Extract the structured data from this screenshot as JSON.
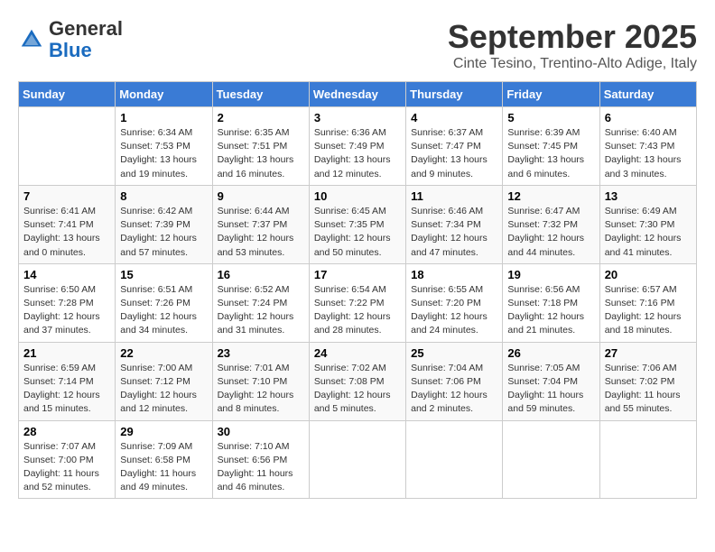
{
  "header": {
    "logo_general": "General",
    "logo_blue": "Blue",
    "month": "September 2025",
    "location": "Cinte Tesino, Trentino-Alto Adige, Italy"
  },
  "weekdays": [
    "Sunday",
    "Monday",
    "Tuesday",
    "Wednesday",
    "Thursday",
    "Friday",
    "Saturday"
  ],
  "weeks": [
    [
      {
        "day": "",
        "info": ""
      },
      {
        "day": "1",
        "info": "Sunrise: 6:34 AM\nSunset: 7:53 PM\nDaylight: 13 hours\nand 19 minutes."
      },
      {
        "day": "2",
        "info": "Sunrise: 6:35 AM\nSunset: 7:51 PM\nDaylight: 13 hours\nand 16 minutes."
      },
      {
        "day": "3",
        "info": "Sunrise: 6:36 AM\nSunset: 7:49 PM\nDaylight: 13 hours\nand 12 minutes."
      },
      {
        "day": "4",
        "info": "Sunrise: 6:37 AM\nSunset: 7:47 PM\nDaylight: 13 hours\nand 9 minutes."
      },
      {
        "day": "5",
        "info": "Sunrise: 6:39 AM\nSunset: 7:45 PM\nDaylight: 13 hours\nand 6 minutes."
      },
      {
        "day": "6",
        "info": "Sunrise: 6:40 AM\nSunset: 7:43 PM\nDaylight: 13 hours\nand 3 minutes."
      }
    ],
    [
      {
        "day": "7",
        "info": "Sunrise: 6:41 AM\nSunset: 7:41 PM\nDaylight: 13 hours\nand 0 minutes."
      },
      {
        "day": "8",
        "info": "Sunrise: 6:42 AM\nSunset: 7:39 PM\nDaylight: 12 hours\nand 57 minutes."
      },
      {
        "day": "9",
        "info": "Sunrise: 6:44 AM\nSunset: 7:37 PM\nDaylight: 12 hours\nand 53 minutes."
      },
      {
        "day": "10",
        "info": "Sunrise: 6:45 AM\nSunset: 7:35 PM\nDaylight: 12 hours\nand 50 minutes."
      },
      {
        "day": "11",
        "info": "Sunrise: 6:46 AM\nSunset: 7:34 PM\nDaylight: 12 hours\nand 47 minutes."
      },
      {
        "day": "12",
        "info": "Sunrise: 6:47 AM\nSunset: 7:32 PM\nDaylight: 12 hours\nand 44 minutes."
      },
      {
        "day": "13",
        "info": "Sunrise: 6:49 AM\nSunset: 7:30 PM\nDaylight: 12 hours\nand 41 minutes."
      }
    ],
    [
      {
        "day": "14",
        "info": "Sunrise: 6:50 AM\nSunset: 7:28 PM\nDaylight: 12 hours\nand 37 minutes."
      },
      {
        "day": "15",
        "info": "Sunrise: 6:51 AM\nSunset: 7:26 PM\nDaylight: 12 hours\nand 34 minutes."
      },
      {
        "day": "16",
        "info": "Sunrise: 6:52 AM\nSunset: 7:24 PM\nDaylight: 12 hours\nand 31 minutes."
      },
      {
        "day": "17",
        "info": "Sunrise: 6:54 AM\nSunset: 7:22 PM\nDaylight: 12 hours\nand 28 minutes."
      },
      {
        "day": "18",
        "info": "Sunrise: 6:55 AM\nSunset: 7:20 PM\nDaylight: 12 hours\nand 24 minutes."
      },
      {
        "day": "19",
        "info": "Sunrise: 6:56 AM\nSunset: 7:18 PM\nDaylight: 12 hours\nand 21 minutes."
      },
      {
        "day": "20",
        "info": "Sunrise: 6:57 AM\nSunset: 7:16 PM\nDaylight: 12 hours\nand 18 minutes."
      }
    ],
    [
      {
        "day": "21",
        "info": "Sunrise: 6:59 AM\nSunset: 7:14 PM\nDaylight: 12 hours\nand 15 minutes."
      },
      {
        "day": "22",
        "info": "Sunrise: 7:00 AM\nSunset: 7:12 PM\nDaylight: 12 hours\nand 12 minutes."
      },
      {
        "day": "23",
        "info": "Sunrise: 7:01 AM\nSunset: 7:10 PM\nDaylight: 12 hours\nand 8 minutes."
      },
      {
        "day": "24",
        "info": "Sunrise: 7:02 AM\nSunset: 7:08 PM\nDaylight: 12 hours\nand 5 minutes."
      },
      {
        "day": "25",
        "info": "Sunrise: 7:04 AM\nSunset: 7:06 PM\nDaylight: 12 hours\nand 2 minutes."
      },
      {
        "day": "26",
        "info": "Sunrise: 7:05 AM\nSunset: 7:04 PM\nDaylight: 11 hours\nand 59 minutes."
      },
      {
        "day": "27",
        "info": "Sunrise: 7:06 AM\nSunset: 7:02 PM\nDaylight: 11 hours\nand 55 minutes."
      }
    ],
    [
      {
        "day": "28",
        "info": "Sunrise: 7:07 AM\nSunset: 7:00 PM\nDaylight: 11 hours\nand 52 minutes."
      },
      {
        "day": "29",
        "info": "Sunrise: 7:09 AM\nSunset: 6:58 PM\nDaylight: 11 hours\nand 49 minutes."
      },
      {
        "day": "30",
        "info": "Sunrise: 7:10 AM\nSunset: 6:56 PM\nDaylight: 11 hours\nand 46 minutes."
      },
      {
        "day": "",
        "info": ""
      },
      {
        "day": "",
        "info": ""
      },
      {
        "day": "",
        "info": ""
      },
      {
        "day": "",
        "info": ""
      }
    ]
  ]
}
